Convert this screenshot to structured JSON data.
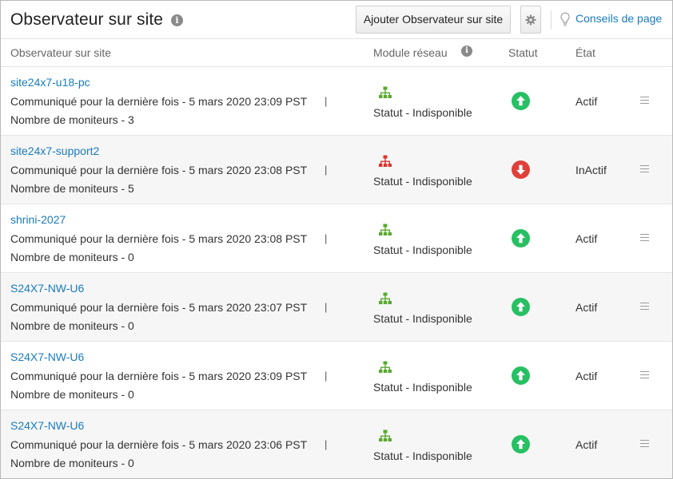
{
  "header": {
    "title": "Observateur sur site",
    "add_button": "Ajouter Observateur sur site",
    "tips_link": "Conseils de page"
  },
  "columns": {
    "observer": "Observateur sur site",
    "network_module": "Module réseau",
    "status": "Statut",
    "state": "État"
  },
  "colors": {
    "link": "#1a7bbd",
    "up": "#27c063",
    "down": "#e0403a",
    "network_ok": "#5aa832",
    "network_bad": "#d9362e"
  },
  "rows": [
    {
      "name": "site24x7-u18-pc",
      "last_comm": "Communiqué pour la dernière fois - 5 mars 2020 23:09 PST",
      "pipe": "|",
      "monitors": "Nombre de moniteurs - 3",
      "network": "Statut - Indisponible",
      "network_icon": "network-ok-icon",
      "status": "up",
      "state": "Actif"
    },
    {
      "name": "site24x7-support2",
      "last_comm": "Communiqué pour la dernière fois - 5 mars 2020 23:08 PST",
      "pipe": "|",
      "monitors": "Nombre de moniteurs - 5",
      "network": "Statut - Indisponible",
      "network_icon": "network-down-icon",
      "status": "down",
      "state": "InActif"
    },
    {
      "name": "shrini-2027",
      "last_comm": "Communiqué pour la dernière fois - 5 mars 2020 23:08 PST",
      "pipe": "|",
      "monitors": "Nombre de moniteurs - 0",
      "network": "Statut - Indisponible",
      "network_icon": "network-ok-icon",
      "status": "up",
      "state": "Actif"
    },
    {
      "name": "S24X7-NW-U6",
      "last_comm": "Communiqué pour la dernière fois - 5 mars 2020 23:07 PST",
      "pipe": "|",
      "monitors": "Nombre de moniteurs - 0",
      "network": "Statut - Indisponible",
      "network_icon": "network-ok-icon",
      "status": "up",
      "state": "Actif"
    },
    {
      "name": "S24X7-NW-U6",
      "last_comm": "Communiqué pour la dernière fois - 5 mars 2020 23:09 PST",
      "pipe": "|",
      "monitors": "Nombre de moniteurs - 0",
      "network": "Statut - Indisponible",
      "network_icon": "network-ok-icon",
      "status": "up",
      "state": "Actif"
    },
    {
      "name": "S24X7-NW-U6",
      "last_comm": "Communiqué pour la dernière fois - 5 mars 2020 23:06 PST",
      "pipe": "|",
      "monitors": "Nombre de moniteurs - 0",
      "network": "Statut - Indisponible",
      "network_icon": "network-ok-icon",
      "status": "up",
      "state": "Actif"
    }
  ]
}
